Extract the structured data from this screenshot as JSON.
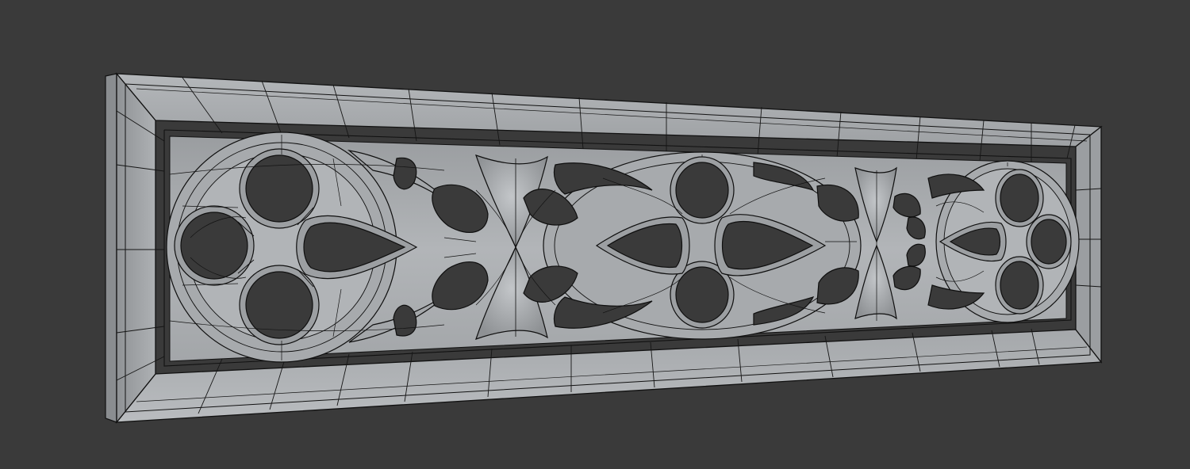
{
  "viewport": {
    "background": "#3a3a3a",
    "shading": "solid",
    "overlay": "wireframe"
  },
  "model": {
    "description_icon": "gothic-tracery-panel-mesh",
    "surface_color": "#a9acaf",
    "edge_color": "#101010",
    "hole_color": "#3a3a3a",
    "bays": 3
  }
}
